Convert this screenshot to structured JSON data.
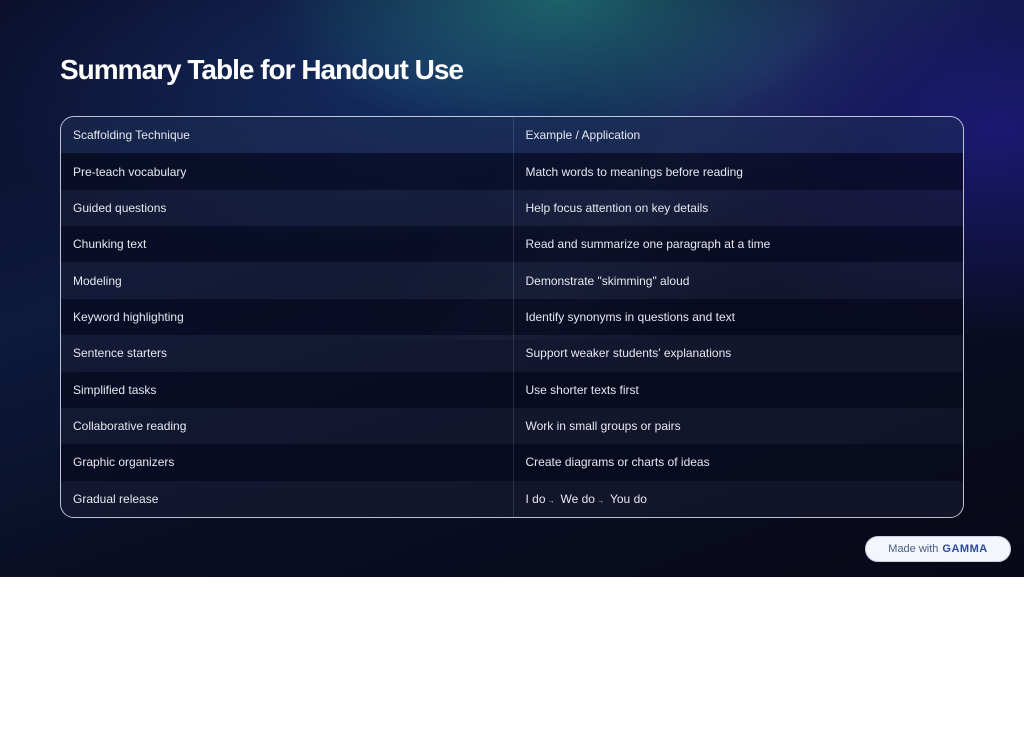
{
  "title": "Summary Table for Handout Use",
  "table": {
    "headers": [
      "Scaffolding Technique",
      "Example / Application"
    ],
    "rows": [
      [
        "Pre-teach vocabulary",
        "Match words to meanings before reading"
      ],
      [
        "Guided questions",
        "Help focus attention on key details"
      ],
      [
        "Chunking text",
        "Read and summarize one paragraph at a time"
      ],
      [
        "Modeling",
        "Demonstrate \"skimming\" aloud"
      ],
      [
        "Keyword highlighting",
        "Identify synonyms in questions and text"
      ],
      [
        "Sentence starters",
        "Support weaker students' explanations"
      ],
      [
        "Simplified tasks",
        "Use shorter texts first"
      ],
      [
        "Collaborative reading",
        "Work in small groups or pairs"
      ],
      [
        "Graphic organizers",
        "Create diagrams or charts of ideas"
      ],
      [
        "Gradual release",
        ""
      ]
    ],
    "gradual_release_steps": [
      "I do",
      "We do",
      "You do"
    ],
    "arrow_glyph": "→"
  },
  "badge": {
    "prefix": "Made with",
    "brand": "GAMMA"
  },
  "colors": {
    "background_dark": "#0a0f26",
    "accent_teal": "#2896a0",
    "accent_indigo": "#281eaa",
    "text": "#e6e8f0"
  }
}
